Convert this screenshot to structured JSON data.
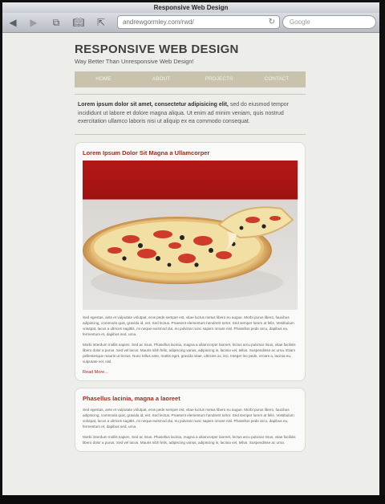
{
  "browser": {
    "window_title": "Responsive Web Design",
    "url": "andrewgormley.com/rwd/",
    "search_placeholder": "Google"
  },
  "site": {
    "title": "RESPONSIVE WEB DESIGN",
    "tagline": "Way Better Than Unresponsive Web Design!",
    "nav": [
      "HOME",
      "ABOUT",
      "PROJECTS",
      "CONTACT"
    ],
    "intro_bold": "Lorem ipsum dolor sit amet, consectetur adipisicing elit,",
    "intro_rest": " sed do eiusmod tempor incididunt ut labore et dolore magna aliqua. Ut enim ad minim veniam, quis nostrud exercitation ullamco laboris nisi ut aliquip ex ea commodo consequat."
  },
  "posts": [
    {
      "title": "Lorem Ipsum Dolor Sit Magna a Ullamcorper",
      "para1": "Sed egestas, ante et vulputate volutpat, eros pede semper est, vitae luctus metus libero eu augue. Morbi purus libero, faucibus adipiscing, commodo quis, gravida id, est. Sed lectus. Praesent elementum hendrerit tortor. Sed semper lorem at felis. Vestibulum volutpat, lacus a ultrices sagittis, mi neque euismod dui, eu pulvinar nunc sapien ornare nisl. Phasellus pede arcu, dapibus eu, fermentum et, dapibus sed, urna.",
      "para2": "Morbi interdum mollis sapien. Sed ac risus. Phasellus lacinia, magna a ullamcorper laoreet, lectus arcu pulvinar risus, vitae facilisis libero dolor a purus. Sed vel lacus. Mauris nibh felis, adipiscing varius, adipiscing in, lacinia vel, tellus. Suspendisse ac urna. Etiam pellentesque mauris ut lectus. Nunc tellus ante, mattis eget, gravida vitae, ultricies ac, leo. Integer leo pede, ornare a, lacinia eu, vulputate vel, nisl.",
      "read_more": "Read More..."
    },
    {
      "title": "Phasellus lacinia, magna a laoreet",
      "para1": "Sed egestas, ante et vulputate volutpat, eros pede semper est, vitae luctus metus libero eu augue. Morbi purus libero, faucibus adipiscing, commodo quis, gravida id, est. Sed lectus. Praesent elementum hendrerit tortor. Sed semper lorem at felis. Vestibulum volutpat, lacus a ultrices sagittis, mi neque euismod dui, eu pulvinar nunc sapien ornare nisl. Phasellus pede arcu, dapibus eu, fermentum et, dapibus sed, urna.",
      "para2": "Morbi interdum mollis sapien. Sed ac risus. Phasellus lacinia, magna a ullamcorper laoreet, lectus arcu pulvinar risus, vitae facilisis libero dolor a purus. Sed vel lacus. Mauris nibh felis, adipiscing varius, adipiscing in, lacinia vel, tellus. Suspendisse ac urna."
    }
  ],
  "colors": {
    "accent": "#9a2c22",
    "nav": "#c9c2ad",
    "page": "#edeee9"
  }
}
